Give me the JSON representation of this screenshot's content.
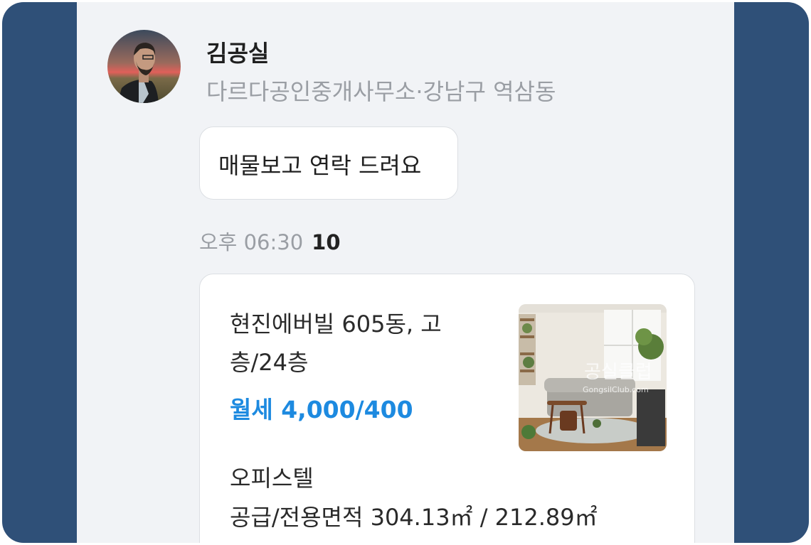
{
  "sender": {
    "name": "김공실",
    "subtitle": "다르다공인중개사무소·강남구 역삼동"
  },
  "message": {
    "text": "매물보고 연락 드려요",
    "time": "오후 06:30",
    "unread_count": "10"
  },
  "listing": {
    "title": "현진에버빌 605동, 고층/24층",
    "price": "월세 4,000/400",
    "type": "오피스텔",
    "area": "공급/전용면적 304.13㎡ / 212.89㎡",
    "watermark": "공실클럽",
    "watermark_url": "GongsilClub.com"
  },
  "colors": {
    "side_bg": "#2f5078",
    "chat_bg": "#f1f3f6",
    "price": "#1d8ae0"
  }
}
